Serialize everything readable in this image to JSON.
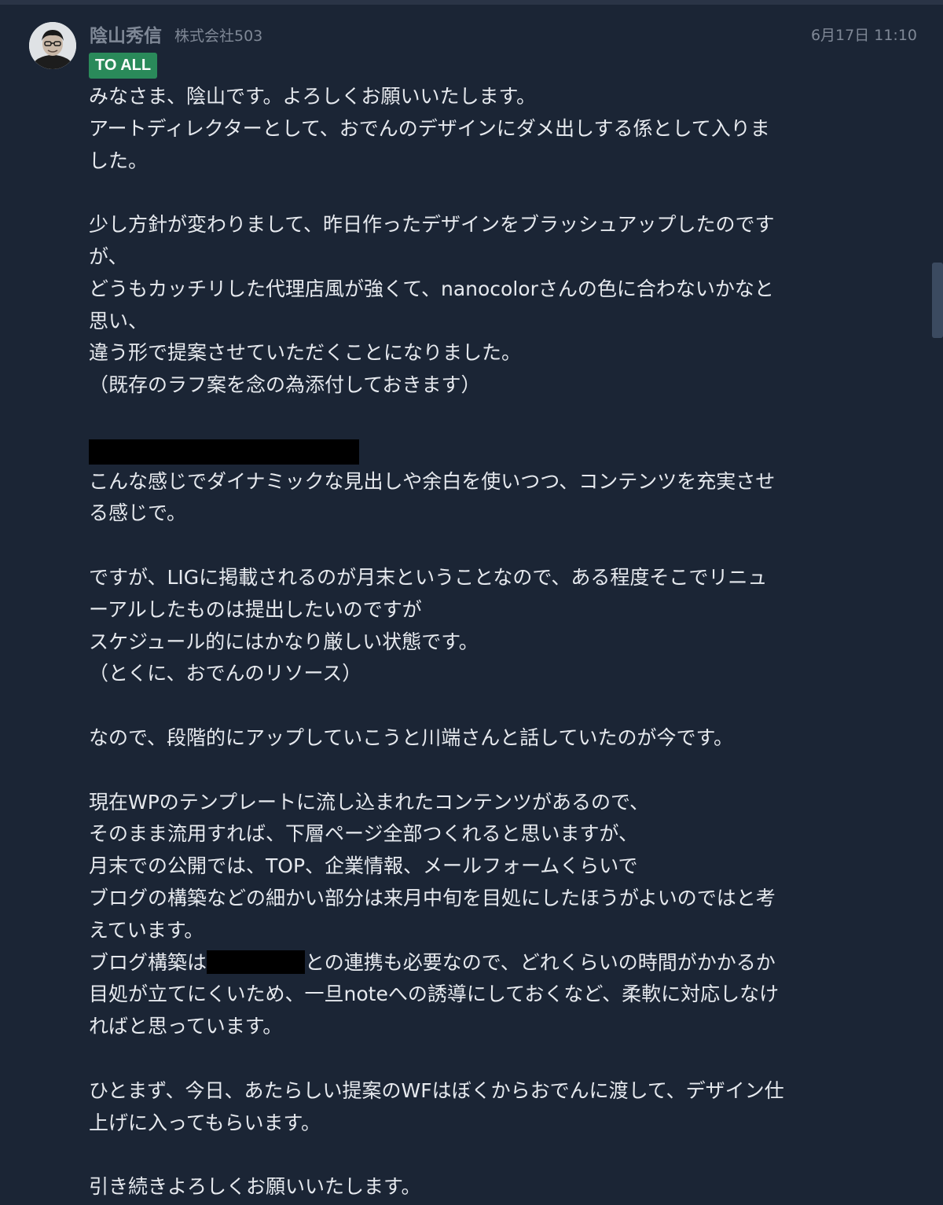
{
  "message": {
    "sender": {
      "name": "陰山秀信",
      "organization": "株式会社503",
      "avatar_icon": "user-avatar-icon"
    },
    "timestamp": "6月17日 11:10",
    "badge": "TO ALL",
    "body": {
      "l01": "みなさま、陰山です。よろしくお願いいたします。",
      "l02": "アートディレクターとして、おでんのデザインにダメ出しする係として入りま",
      "l03": "した。",
      "l05": "少し方針が変わりまして、昨日作ったデザインをブラッシュアップしたのです",
      "l06": "が、",
      "l07": "どうもカッチリした代理店風が強くて、nanocolorさんの色に合わないかなと",
      "l08": "思い、",
      "l09": "違う形で提案させていただくことになりました。",
      "l10": "（既存のラフ案を念の為添付しておきます）",
      "l13": "こんな感じでダイナミックな見出しや余白を使いつつ、コンテンツを充実させ",
      "l14": "る感じで。",
      "l16": "ですが、LIGに掲載されるのが月末ということなので、ある程度そこでリニュ",
      "l17": "ーアルしたものは提出したいのですが",
      "l18": "スケジュール的にはかなり厳しい状態です。",
      "l19": "（とくに、おでんのリソース）",
      "l21": "なので、段階的にアップしていこうと川端さんと話していたのが今です。",
      "l23": "現在WPのテンプレートに流し込まれたコンテンツがあるので、",
      "l24": "そのまま流用すれば、下層ページ全部つくれると思いますが、",
      "l25": "月末での公開では、TOP、企業情報、メールフォームくらいで",
      "l26": "ブログの構築などの細かい部分は来月中旬を目処にしたほうがよいのではと考",
      "l27": "えています。",
      "l28a": "ブログ構築は",
      "l28b": "との連携も必要なので、どれくらいの時間がかかるか",
      "l29": "目処が立てにくいため、一旦noteへの誘導にしておくなど、柔軟に対応しなけ",
      "l30": "ればと思っています。",
      "l32": "ひとまず、今日、あたらしい提案のWFはぼくからおでんに渡して、デザイン仕",
      "l33": "上げに入ってもらいます。",
      "l35": "引き続きよろしくお願いいたします。"
    }
  },
  "colors": {
    "background": "#1b2535",
    "text": "#e6e9ee",
    "muted": "#7f8896",
    "badge": "#2a8a5a",
    "redaction": "#000000"
  }
}
